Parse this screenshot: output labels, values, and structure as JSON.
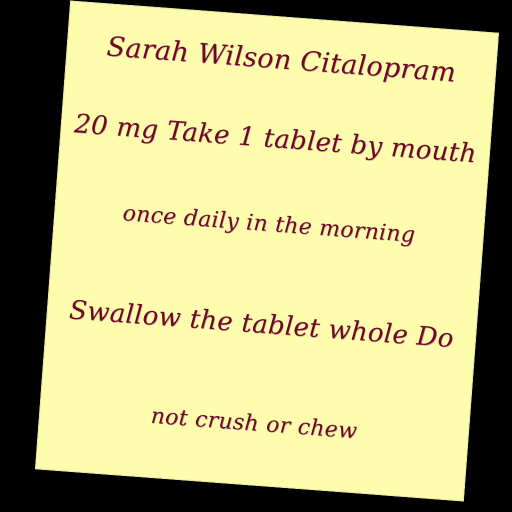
{
  "note": {
    "lines": [
      "Sarah Wilson Citalopram",
      "20 mg Take 1 tablet by mouth",
      "once daily in the morning",
      "Swallow the tablet whole Do",
      "not crush or chew"
    ],
    "paper_color": "#fefdae",
    "ink_color": "#6b0a1f"
  }
}
